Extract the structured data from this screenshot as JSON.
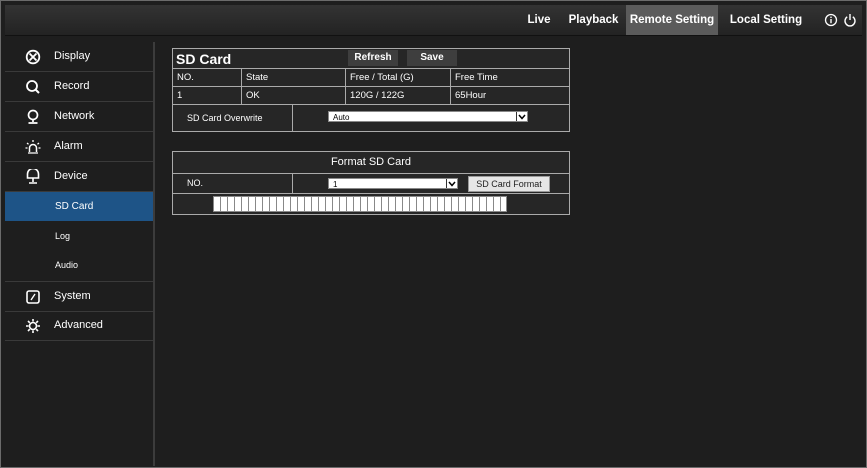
{
  "topnav": {
    "live": "Live",
    "playback": "Playback",
    "remote_setting": "Remote Setting",
    "local_setting": "Local Setting"
  },
  "sidebar": {
    "items": [
      {
        "label": "Display",
        "icon": "display-icon"
      },
      {
        "label": "Record",
        "icon": "record-icon"
      },
      {
        "label": "Network",
        "icon": "network-icon"
      },
      {
        "label": "Alarm",
        "icon": "alarm-icon"
      },
      {
        "label": "Device",
        "icon": "device-icon"
      },
      {
        "label": "System",
        "icon": "system-icon"
      },
      {
        "label": "Advanced",
        "icon": "advanced-icon"
      }
    ],
    "subitems": [
      "SD Card",
      "Log",
      "Audio"
    ]
  },
  "sd_panel": {
    "title": "SD Card",
    "refresh_label": "Refresh",
    "save_label": "Save",
    "headers": [
      "NO.",
      "State",
      "Free / Total (G)",
      "Free Time"
    ],
    "row": [
      "1",
      "OK",
      "120G / 122G",
      "65Hour"
    ],
    "overwrite_label": "SD Card Overwrite",
    "overwrite_value": "Auto"
  },
  "format_panel": {
    "title": "Format SD Card",
    "no_label": "NO.",
    "no_value": "1",
    "format_button": "SD Card Format"
  },
  "colors": {
    "accent": "#1e5487",
    "active_tab": "#5b5b5b"
  }
}
